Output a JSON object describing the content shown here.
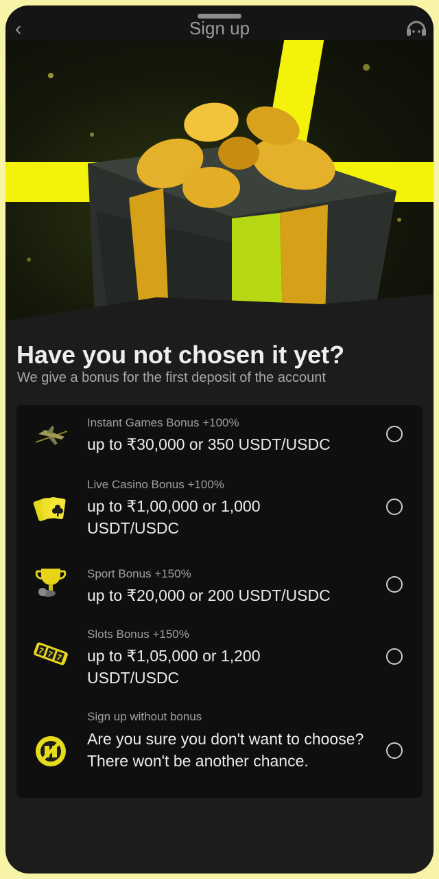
{
  "header": {
    "title": "Sign up",
    "back_icon": "chevron-left-icon",
    "support_icon": "headset-icon"
  },
  "heading": "Have you not chosen it yet?",
  "subheading": "We give a bonus for the first deposit of the account",
  "options": [
    {
      "label": "Instant Games Bonus +100%",
      "value": "up to ₹30,000 or 350 USDT/USDC",
      "icon": "airplane-icon"
    },
    {
      "label": "Live Casino Bonus +100%",
      "value": "up to ₹1,00,000 or 1,000 USDT/USDC",
      "icon": "playing-cards-icon"
    },
    {
      "label": "Sport Bonus +150%",
      "value": "up to ₹20,000 or 200 USDT/USDC",
      "icon": "trophy-icon"
    },
    {
      "label": "Slots Bonus +150%",
      "value": "up to ₹1,05,000 or 1,200 USDT/USDC",
      "icon": "slot-reels-icon"
    },
    {
      "label": "Sign up without bonus",
      "value": "Are you sure you don't want to choose? There won't be another chance.",
      "icon": "no-gift-icon"
    }
  ],
  "colors": {
    "accent": "#f2f20a",
    "background": "#1c1c1c",
    "card": "#0f0f0f",
    "gold": "#e0a41c"
  }
}
